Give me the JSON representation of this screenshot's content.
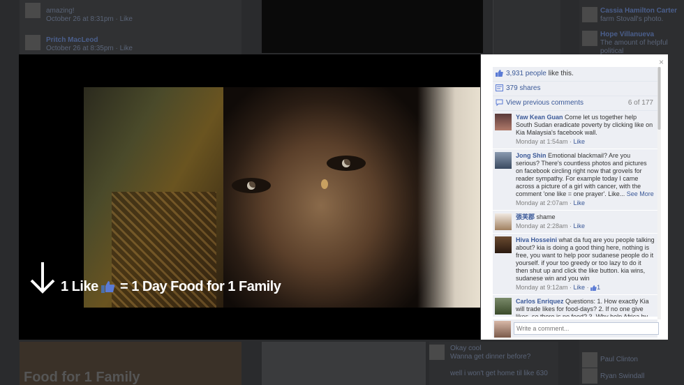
{
  "background": {
    "posts": [
      {
        "name": "",
        "text": "amazing!",
        "time": "October 26 at 8:31pm · Like"
      },
      {
        "name": "Pritch MacLeod",
        "text": "",
        "time": "October 26 at 8:35pm · Like"
      }
    ],
    "right_names": [
      "Cassia Hamilton Carter",
      "Hope Villanueva"
    ],
    "right_subtexts": [
      "farm Stovall's photo.",
      "The amount of helpful political"
    ],
    "bottom_caption": "Food for 1 Family",
    "bottom_comments": [
      "Okay cool",
      "Wanna get dinner before?",
      "well i won't get home til like 630"
    ],
    "bottom_right_names": [
      "Paul Clinton",
      "Ryan Swindall"
    ]
  },
  "photo": {
    "caption_part1": "1 Like",
    "caption_part2": "= 1 Day Food for 1 Family"
  },
  "panel": {
    "close_label": "×",
    "likes_count": "3,931 people",
    "likes_suffix": " like this.",
    "shares": "379 shares",
    "view_previous": "View previous comments",
    "comment_count": "6 of 177",
    "write_placeholder": "Write a comment...",
    "comments": [
      {
        "author": "Yaw Kean Guan",
        "text": "Come let us together help South Sudan eradicate poverty by clicking like on Kia Malaysia's facebook wall.",
        "time": "Monday at 1:54am",
        "like": "Like",
        "likes": "",
        "see_more": ""
      },
      {
        "author": "Jong Shin",
        "text": "Emotional blackmail? Are you serious? There's countless photos and pictures on facebook circling right now that grovels for reader sympathy. For example today I came across a picture of a girl with cancer, with the comment 'one like = one prayer'. Like...",
        "time": "Monday at 2:07am",
        "like": "Like",
        "likes": "",
        "see_more": "See More"
      },
      {
        "author": "張芙郡",
        "text": "shame",
        "time": "Monday at 2:28am",
        "like": "Like",
        "likes": "",
        "see_more": ""
      },
      {
        "author": "Hiva Hosseini",
        "text": "what da fuq are you people talking about? kia is doing a good thing here, nothing is free, you want to help poor sudanese people do it yourself. if your too greedy or too lazy to do it then shut up and click the like button. kia wins, sudanese win and you win",
        "time": "Monday at 9:12am",
        "like": "Like",
        "likes": "1",
        "see_more": ""
      },
      {
        "author": "Carlos Enriquez",
        "text": "Questions: 1. How exactly Kia will trade likes for food-days? 2. If no one give likes, so there is no food? 3. Why help Africa by",
        "time": "",
        "like": "",
        "likes": "",
        "see_more": ""
      }
    ]
  },
  "colors": {
    "link": "#3b5998",
    "panel_bg": "#edeff4"
  }
}
